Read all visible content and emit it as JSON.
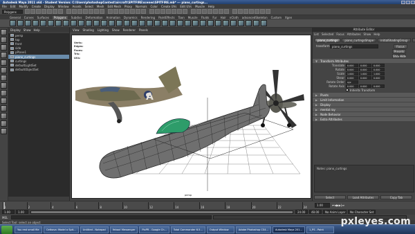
{
  "app": {
    "title": "Autodesk Maya 2011 x64 - Student Version: C:\\Users\\photoshopContest\\aircraft\\SPITFIRE\\scenes\\SPITFIRE.mb*   ---   piano_curtings..."
  },
  "menubar": [
    "File",
    "Edit",
    "Modify",
    "Create",
    "Display",
    "Window",
    "Assets",
    "Select",
    "Mesh",
    "Edit Mesh",
    "Proxy",
    "Normals",
    "Color",
    "Create UVs",
    "Edit UVs",
    "Muscle",
    "Help"
  ],
  "mode_select": "Polygons",
  "shelf_tabs": [
    "General",
    "Curves",
    "Surfaces",
    "Polygons",
    "Subdivs",
    "Deformation",
    "Animation",
    "Dynamics",
    "Rendering",
    "PaintEffects",
    "Toon",
    "Muscle",
    "Fluids",
    "Fur",
    "Hair",
    "nCloth",
    "advancedSkeleton",
    "Custom",
    "Xgen"
  ],
  "shelf_active": "Polygons",
  "outliner": {
    "menu": [
      "Display",
      "Show",
      "Help"
    ],
    "items": [
      {
        "label": "persp",
        "selected": false
      },
      {
        "label": "top",
        "selected": false
      },
      {
        "label": "front",
        "selected": false
      },
      {
        "label": "side",
        "selected": false
      },
      {
        "label": "pPlane1",
        "selected": false
      },
      {
        "label": "piano_curtings",
        "selected": true
      },
      {
        "label": "curtings",
        "selected": false
      },
      {
        "label": "defaultLightSet",
        "selected": false
      },
      {
        "label": "defaultObjectSet",
        "selected": false
      }
    ]
  },
  "viewport": {
    "menu": [
      "View",
      "Shading",
      "Lighting",
      "Show",
      "Renderer",
      "Panels"
    ],
    "hud": [
      "Verts:",
      "Edges:",
      "Faces:",
      "Tris:",
      "UVs:"
    ],
    "camera": "persp"
  },
  "attribute_editor": {
    "title": "Attribute Editor",
    "menu": [
      "List",
      "Selected",
      "Focus",
      "Attributes",
      "Show",
      "Help"
    ],
    "node_tabs": [
      "piano_curtings",
      "piano_curtingsShape",
      "initialShadingGroup",
      "lambert1"
    ],
    "transform_label": "transform:",
    "transform_value": "piano_curtings",
    "focus_button": "Focus",
    "presets_button": "Presets",
    "show_button": "Show",
    "hide_button": "Hide",
    "sections_open": "Transform Attributes",
    "attributes": [
      {
        "label": "Translate",
        "values": [
          "0.000",
          "0.000",
          "0.000"
        ]
      },
      {
        "label": "Rotate",
        "values": [
          "0.000",
          "0.000",
          "0.000"
        ]
      },
      {
        "label": "Scale",
        "values": [
          "1.000",
          "1.000",
          "1.000"
        ]
      },
      {
        "label": "Shear",
        "values": [
          "0.000",
          "0.000",
          "0.000"
        ]
      },
      {
        "label": "Rotate Order",
        "values": [
          "xyz"
        ]
      },
      {
        "label": "Rotate Axis",
        "values": [
          "0.000",
          "0.000",
          "0.000"
        ]
      }
    ],
    "inherits_label": "Inherits Transform",
    "sections": [
      "Pivots",
      "Limit Information",
      "Display",
      "mental ray",
      "Node Behavior",
      "Extra Attributes"
    ],
    "notes_label": "Notes: piano_curtings",
    "bottom_buttons": [
      "Select",
      "Load Attributes",
      "Copy Tab"
    ]
  },
  "timeline": {
    "ticks": [
      "1",
      "2",
      "4",
      "6",
      "8",
      "10",
      "12",
      "14",
      "16",
      "18",
      "20",
      "22",
      "24"
    ],
    "current": "1.00",
    "start": "1.00",
    "end": "24.00",
    "range_end": "48.00",
    "anim_layer": "No Anim Layer",
    "char_set": "No Character Set"
  },
  "command": {
    "label": "MEL"
  },
  "helpline": "Select Tool: select an object",
  "taskbar": {
    "items": [
      {
        "label": "You rest small file",
        "active": false
      },
      {
        "label": "Cetkova: Model a Spit...",
        "active": false
      },
      {
        "label": "Untitled - Notepad",
        "active": false
      },
      {
        "label": "Yahoo! Messenger",
        "active": false
      },
      {
        "label": "PixPR - Google Ch...",
        "active": false
      },
      {
        "label": "Total Commander 6.5...",
        "active": false
      },
      {
        "label": "Output Window",
        "active": false
      },
      {
        "label": "Adobe Photoshop CS4...",
        "active": false
      },
      {
        "label": "Autodesk Maya 201...",
        "active": true
      },
      {
        "label": "1_PS - Paint",
        "active": false
      }
    ]
  },
  "watermark": "pxleyes.com",
  "colors": {
    "selection": "#6a8cab",
    "wireframe_green": "#2e9c6a",
    "viewport_bg": "#ffffff"
  }
}
